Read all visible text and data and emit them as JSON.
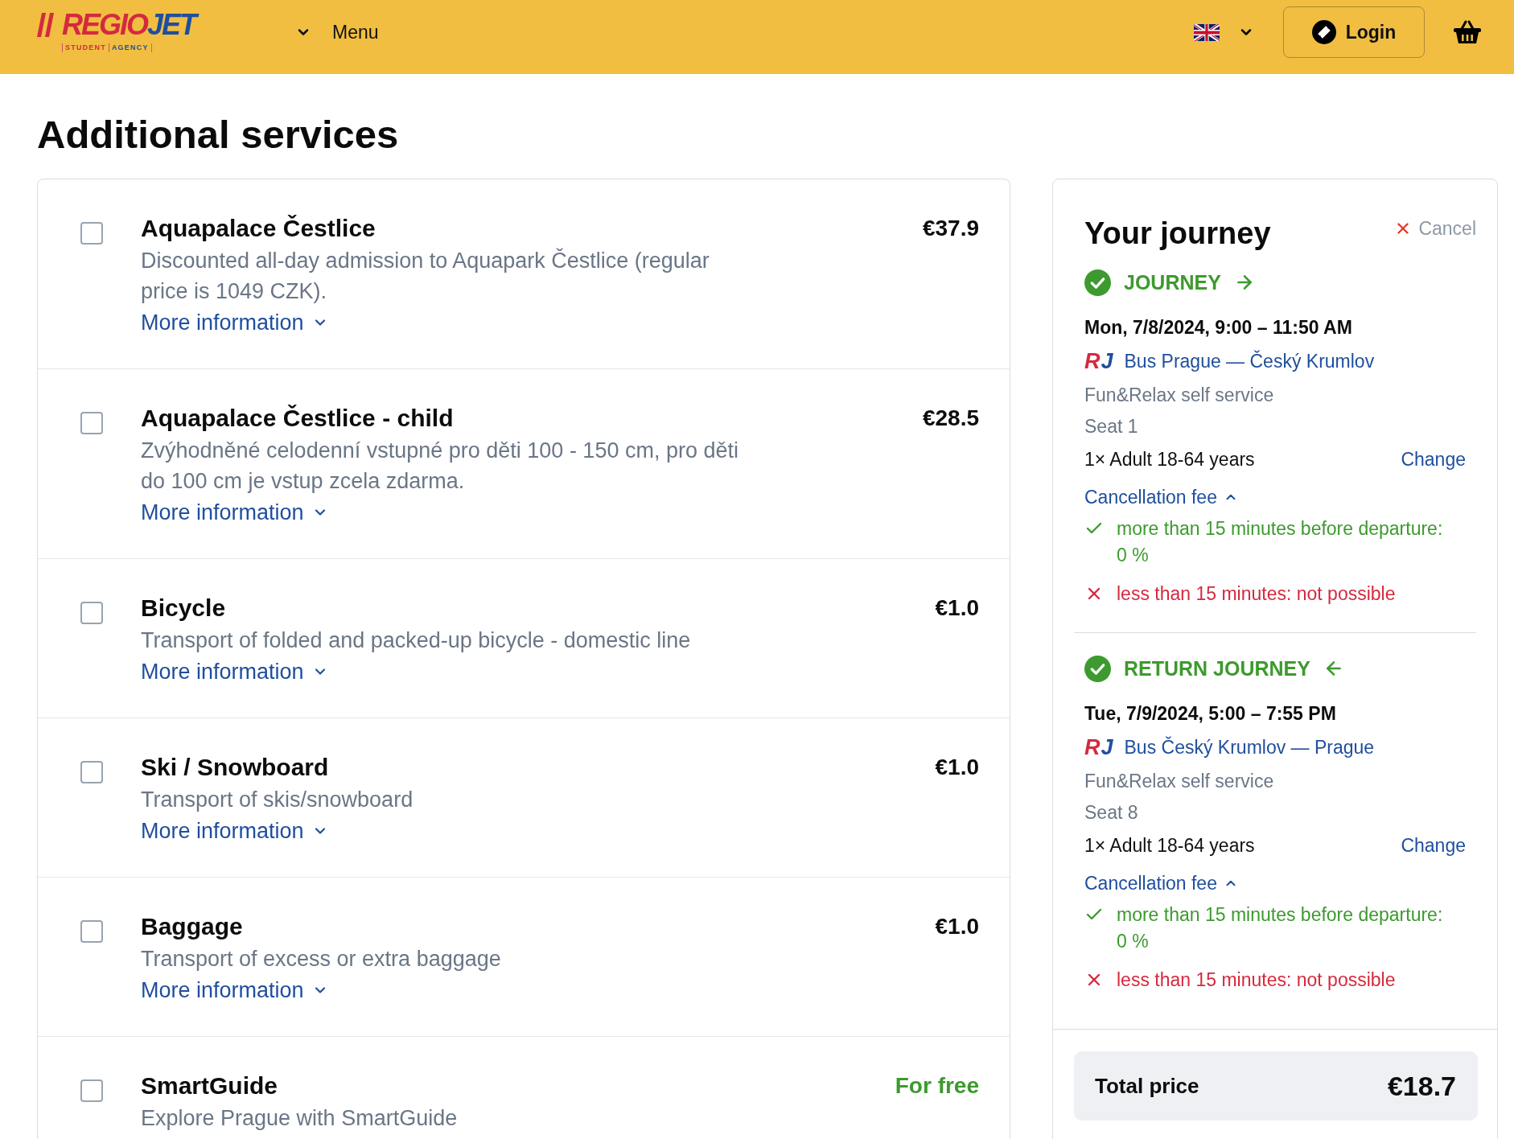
{
  "header": {
    "logo": {
      "name_left": "REGIO",
      "name_right": "JET",
      "tagline_left": "STUDENT",
      "tagline_right": "AGENCY"
    },
    "menu": {
      "label": "Menu",
      "expanded": false
    },
    "language": {
      "expanded": false
    },
    "login": {
      "label": "Login"
    }
  },
  "page_title": "Additional services",
  "services": [
    {
      "kind": "paid",
      "name": "Aquapalace Čestlice",
      "description": "Discounted all-day admission to Aquapark Čestlice (regular price is 1049 CZK).",
      "more_info": {
        "label": "More information",
        "expanded": false
      },
      "price": "€37.9",
      "checked": false
    },
    {
      "kind": "paid",
      "name": "Aquapalace Čestlice - child",
      "description": "Zvýhodněné celodenní vstupné pro děti 100 - 150 cm, pro děti do 100 cm je vstup zcela zdarma.",
      "more_info": {
        "label": "More information",
        "expanded": false
      },
      "price": "€28.5",
      "checked": false
    },
    {
      "kind": "paid",
      "name": "Bicycle",
      "description": "Transport of folded and packed-up bicycle - domestic line",
      "more_info": {
        "label": "More information",
        "expanded": false
      },
      "price": "€1.0",
      "checked": false
    },
    {
      "kind": "paid",
      "name": "Ski / Snowboard",
      "description": "Transport of skis/snowboard",
      "more_info": {
        "label": "More information",
        "expanded": false
      },
      "price": "€1.0",
      "checked": false
    },
    {
      "kind": "paid",
      "name": "Baggage",
      "description": "Transport of excess or extra baggage",
      "more_info": {
        "label": "More information",
        "expanded": false
      },
      "price": "€1.0",
      "checked": false
    },
    {
      "kind": "free",
      "name": "SmartGuide",
      "description": "Explore Prague with SmartGuide",
      "price": "For free",
      "checked": false
    }
  ],
  "journey": {
    "title": "Your journey",
    "cancel": "Cancel",
    "legs": [
      {
        "kind": "outbound",
        "heading": "JOURNEY",
        "date": "Mon, 7/8/2024, 9:00 – 11:50 AM",
        "operator_logo": {
          "left": "R",
          "right": "J"
        },
        "route": "Bus Prague — Český Krumlov",
        "tariff": "Fun&Relax self service",
        "seat": "Seat 1",
        "passengers": "1× Adult 18-64 years",
        "change": "Change",
        "fee_label": "Cancellation fee",
        "fee_expanded": true,
        "fee_rules": [
          {
            "kind": "allowed",
            "text": "more than 15 minutes before departure: 0 %"
          },
          {
            "kind": "denied",
            "text": "less than 15 minutes: not possible"
          }
        ]
      },
      {
        "kind": "return",
        "heading": "RETURN JOURNEY",
        "date": "Tue, 7/9/2024, 5:00 – 7:55 PM",
        "operator_logo": {
          "left": "R",
          "right": "J"
        },
        "route": "Bus Český Krumlov — Prague",
        "tariff": "Fun&Relax self service",
        "seat": "Seat 8",
        "passengers": "1× Adult 18-64 years",
        "change": "Change",
        "fee_label": "Cancellation fee",
        "fee_expanded": true,
        "fee_rules": [
          {
            "kind": "allowed",
            "text": "more than 15 minutes before departure: 0 %"
          },
          {
            "kind": "denied",
            "text": "less than 15 minutes: not possible"
          }
        ]
      }
    ],
    "total": {
      "label": "Total price",
      "value": "€18.7"
    }
  }
}
